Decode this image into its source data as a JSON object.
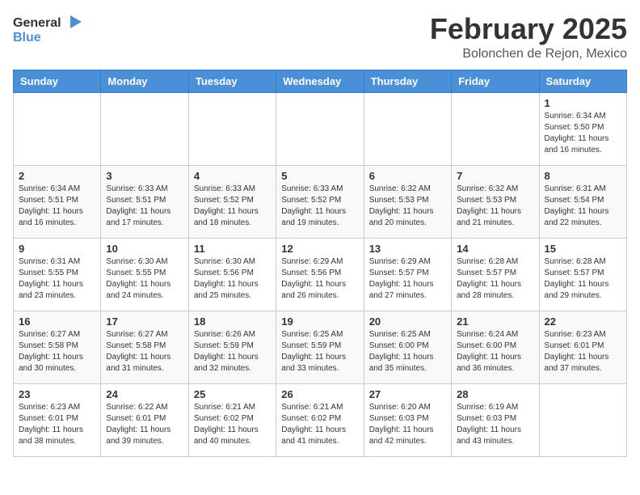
{
  "header": {
    "logo_general": "General",
    "logo_blue": "Blue",
    "month": "February 2025",
    "location": "Bolonchen de Rejon, Mexico"
  },
  "weekdays": [
    "Sunday",
    "Monday",
    "Tuesday",
    "Wednesday",
    "Thursday",
    "Friday",
    "Saturday"
  ],
  "weeks": [
    [
      {
        "day": "",
        "info": ""
      },
      {
        "day": "",
        "info": ""
      },
      {
        "day": "",
        "info": ""
      },
      {
        "day": "",
        "info": ""
      },
      {
        "day": "",
        "info": ""
      },
      {
        "day": "",
        "info": ""
      },
      {
        "day": "1",
        "info": "Sunrise: 6:34 AM\nSunset: 5:50 PM\nDaylight: 11 hours\nand 16 minutes."
      }
    ],
    [
      {
        "day": "2",
        "info": "Sunrise: 6:34 AM\nSunset: 5:51 PM\nDaylight: 11 hours\nand 16 minutes."
      },
      {
        "day": "3",
        "info": "Sunrise: 6:33 AM\nSunset: 5:51 PM\nDaylight: 11 hours\nand 17 minutes."
      },
      {
        "day": "4",
        "info": "Sunrise: 6:33 AM\nSunset: 5:52 PM\nDaylight: 11 hours\nand 18 minutes."
      },
      {
        "day": "5",
        "info": "Sunrise: 6:33 AM\nSunset: 5:52 PM\nDaylight: 11 hours\nand 19 minutes."
      },
      {
        "day": "6",
        "info": "Sunrise: 6:32 AM\nSunset: 5:53 PM\nDaylight: 11 hours\nand 20 minutes."
      },
      {
        "day": "7",
        "info": "Sunrise: 6:32 AM\nSunset: 5:53 PM\nDaylight: 11 hours\nand 21 minutes."
      },
      {
        "day": "8",
        "info": "Sunrise: 6:31 AM\nSunset: 5:54 PM\nDaylight: 11 hours\nand 22 minutes."
      }
    ],
    [
      {
        "day": "9",
        "info": "Sunrise: 6:31 AM\nSunset: 5:55 PM\nDaylight: 11 hours\nand 23 minutes."
      },
      {
        "day": "10",
        "info": "Sunrise: 6:30 AM\nSunset: 5:55 PM\nDaylight: 11 hours\nand 24 minutes."
      },
      {
        "day": "11",
        "info": "Sunrise: 6:30 AM\nSunset: 5:56 PM\nDaylight: 11 hours\nand 25 minutes."
      },
      {
        "day": "12",
        "info": "Sunrise: 6:29 AM\nSunset: 5:56 PM\nDaylight: 11 hours\nand 26 minutes."
      },
      {
        "day": "13",
        "info": "Sunrise: 6:29 AM\nSunset: 5:57 PM\nDaylight: 11 hours\nand 27 minutes."
      },
      {
        "day": "14",
        "info": "Sunrise: 6:28 AM\nSunset: 5:57 PM\nDaylight: 11 hours\nand 28 minutes."
      },
      {
        "day": "15",
        "info": "Sunrise: 6:28 AM\nSunset: 5:57 PM\nDaylight: 11 hours\nand 29 minutes."
      }
    ],
    [
      {
        "day": "16",
        "info": "Sunrise: 6:27 AM\nSunset: 5:58 PM\nDaylight: 11 hours\nand 30 minutes."
      },
      {
        "day": "17",
        "info": "Sunrise: 6:27 AM\nSunset: 5:58 PM\nDaylight: 11 hours\nand 31 minutes."
      },
      {
        "day": "18",
        "info": "Sunrise: 6:26 AM\nSunset: 5:59 PM\nDaylight: 11 hours\nand 32 minutes."
      },
      {
        "day": "19",
        "info": "Sunrise: 6:25 AM\nSunset: 5:59 PM\nDaylight: 11 hours\nand 33 minutes."
      },
      {
        "day": "20",
        "info": "Sunrise: 6:25 AM\nSunset: 6:00 PM\nDaylight: 11 hours\nand 35 minutes."
      },
      {
        "day": "21",
        "info": "Sunrise: 6:24 AM\nSunset: 6:00 PM\nDaylight: 11 hours\nand 36 minutes."
      },
      {
        "day": "22",
        "info": "Sunrise: 6:23 AM\nSunset: 6:01 PM\nDaylight: 11 hours\nand 37 minutes."
      }
    ],
    [
      {
        "day": "23",
        "info": "Sunrise: 6:23 AM\nSunset: 6:01 PM\nDaylight: 11 hours\nand 38 minutes."
      },
      {
        "day": "24",
        "info": "Sunrise: 6:22 AM\nSunset: 6:01 PM\nDaylight: 11 hours\nand 39 minutes."
      },
      {
        "day": "25",
        "info": "Sunrise: 6:21 AM\nSunset: 6:02 PM\nDaylight: 11 hours\nand 40 minutes."
      },
      {
        "day": "26",
        "info": "Sunrise: 6:21 AM\nSunset: 6:02 PM\nDaylight: 11 hours\nand 41 minutes."
      },
      {
        "day": "27",
        "info": "Sunrise: 6:20 AM\nSunset: 6:03 PM\nDaylight: 11 hours\nand 42 minutes."
      },
      {
        "day": "28",
        "info": "Sunrise: 6:19 AM\nSunset: 6:03 PM\nDaylight: 11 hours\nand 43 minutes."
      },
      {
        "day": "",
        "info": ""
      }
    ]
  ],
  "colors": {
    "header_bg": "#4a90d9",
    "accent": "#4a90d9"
  }
}
